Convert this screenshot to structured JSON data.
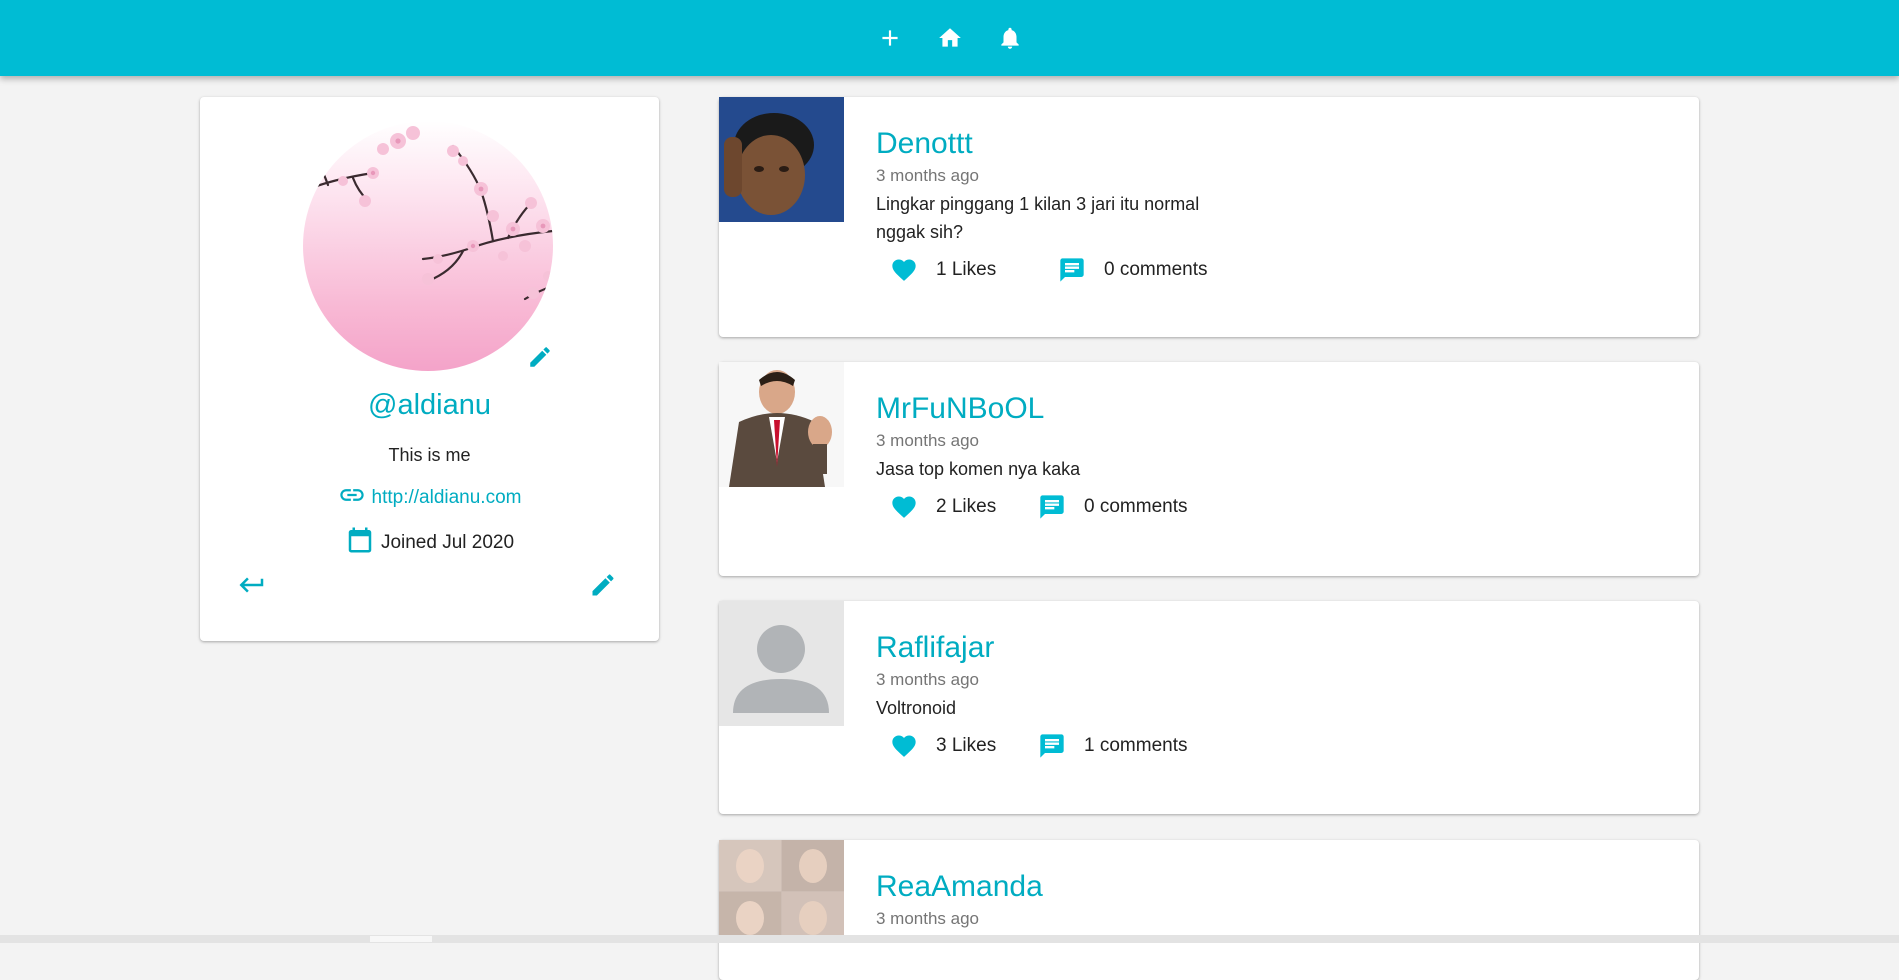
{
  "topbar": {
    "add_icon": "plus-icon",
    "home_icon": "home-icon",
    "notifications_icon": "bell-icon",
    "color": "#00bcd4"
  },
  "profile": {
    "handle": "@aldianu",
    "bio": "This is me",
    "website": "http://aldianu.com",
    "joined": "Joined Jul 2020",
    "accent": "#00acc1"
  },
  "posts": [
    {
      "username": "Denottt",
      "time": "3 months ago",
      "body": "Lingkar pinggang 1 kilan 3 jari itu normal nggak sih?",
      "likes": "1 Likes",
      "comments": "0 comments"
    },
    {
      "username": "MrFuNBoOL",
      "time": "3 months ago",
      "body": "Jasa top komen nya kaka",
      "likes": "2 Likes",
      "comments": "0 comments"
    },
    {
      "username": "Raflifajar",
      "time": "3 months ago",
      "body": "Voltronoid",
      "likes": "3 Likes",
      "comments": "1 comments"
    },
    {
      "username": "ReaAmanda",
      "time": "3 months ago"
    }
  ]
}
